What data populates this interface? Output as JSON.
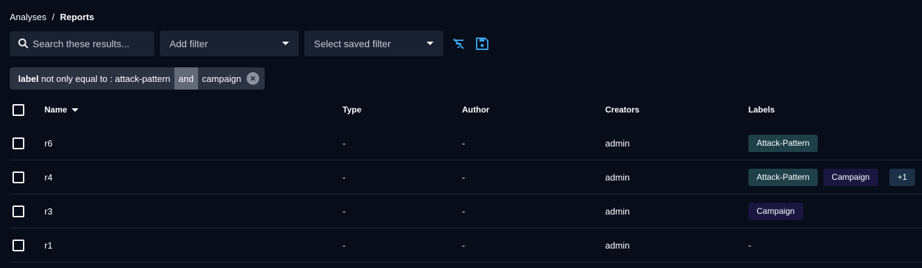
{
  "breadcrumb": {
    "parent": "Analyses",
    "separator": "/",
    "current": "Reports"
  },
  "toolbar": {
    "search_placeholder": "Search these results...",
    "add_filter_label": "Add filter",
    "saved_filter_label": "Select saved filter",
    "clear_filters_icon": "filter-off-icon",
    "save_icon": "save-icon"
  },
  "active_filter": {
    "key": "label",
    "operator": "not only equal to :",
    "value1": "attack-pattern",
    "conjunction": "and",
    "value2": "campaign"
  },
  "table": {
    "headers": {
      "name": "Name",
      "type": "Type",
      "author": "Author",
      "creators": "Creators",
      "labels": "Labels"
    },
    "rows": [
      {
        "name": "r6",
        "type": "-",
        "author": "-",
        "creators": "admin",
        "labels": [
          "Attack-Pattern"
        ],
        "extra": "",
        "empty_labels": ""
      },
      {
        "name": "r4",
        "type": "-",
        "author": "-",
        "creators": "admin",
        "labels": [
          "Attack-Pattern",
          "Campaign"
        ],
        "extra": "+1",
        "empty_labels": ""
      },
      {
        "name": "r3",
        "type": "-",
        "author": "-",
        "creators": "admin",
        "labels": [
          "Campaign"
        ],
        "extra": "",
        "empty_labels": ""
      },
      {
        "name": "r1",
        "type": "-",
        "author": "-",
        "creators": "admin",
        "labels": [],
        "extra": "",
        "empty_labels": "-"
      }
    ]
  },
  "colors": {
    "background": "#070d19",
    "accent_icon": "#3aa3e8",
    "attack_pattern_label": "#1e4049",
    "campaign_label": "#1a1640"
  }
}
